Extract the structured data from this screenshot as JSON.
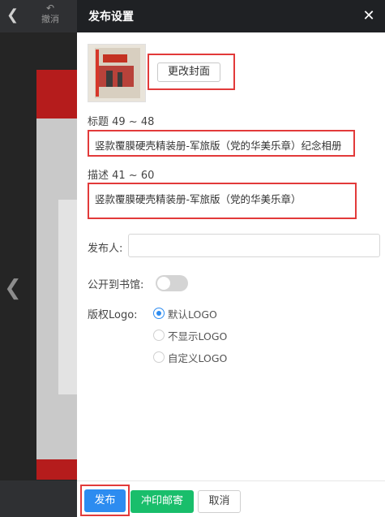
{
  "editor": {
    "undo_label": "撤消"
  },
  "panel": {
    "title": "发布设置",
    "change_cover_label": "更改封面",
    "title_label": "标题 49 ~ 48",
    "title_value": "竖款覆膜硬壳精装册-军旅版（党的华美乐章）纪念相册",
    "desc_label": "描述 41 ~ 60",
    "desc_value": "竖款覆膜硬壳精装册-军旅版（党的华美乐章）",
    "publisher_label": "发布人:",
    "publisher_value": "",
    "public_label": "公开到书馆:",
    "public_enabled": false,
    "logo_label": "版权Logo:",
    "logo_options": [
      "默认LOGO",
      "不显示LOGO",
      "自定义LOGO"
    ],
    "logo_selected": "默认LOGO"
  },
  "footer": {
    "publish_label": "发布",
    "print_label": "冲印邮寄",
    "cancel_label": "取消"
  },
  "colors": {
    "accent_blue": "#2d8cf0",
    "accent_green": "#19be6b",
    "highlight_red": "#e23a3a",
    "header_dark": "#1f2124"
  }
}
